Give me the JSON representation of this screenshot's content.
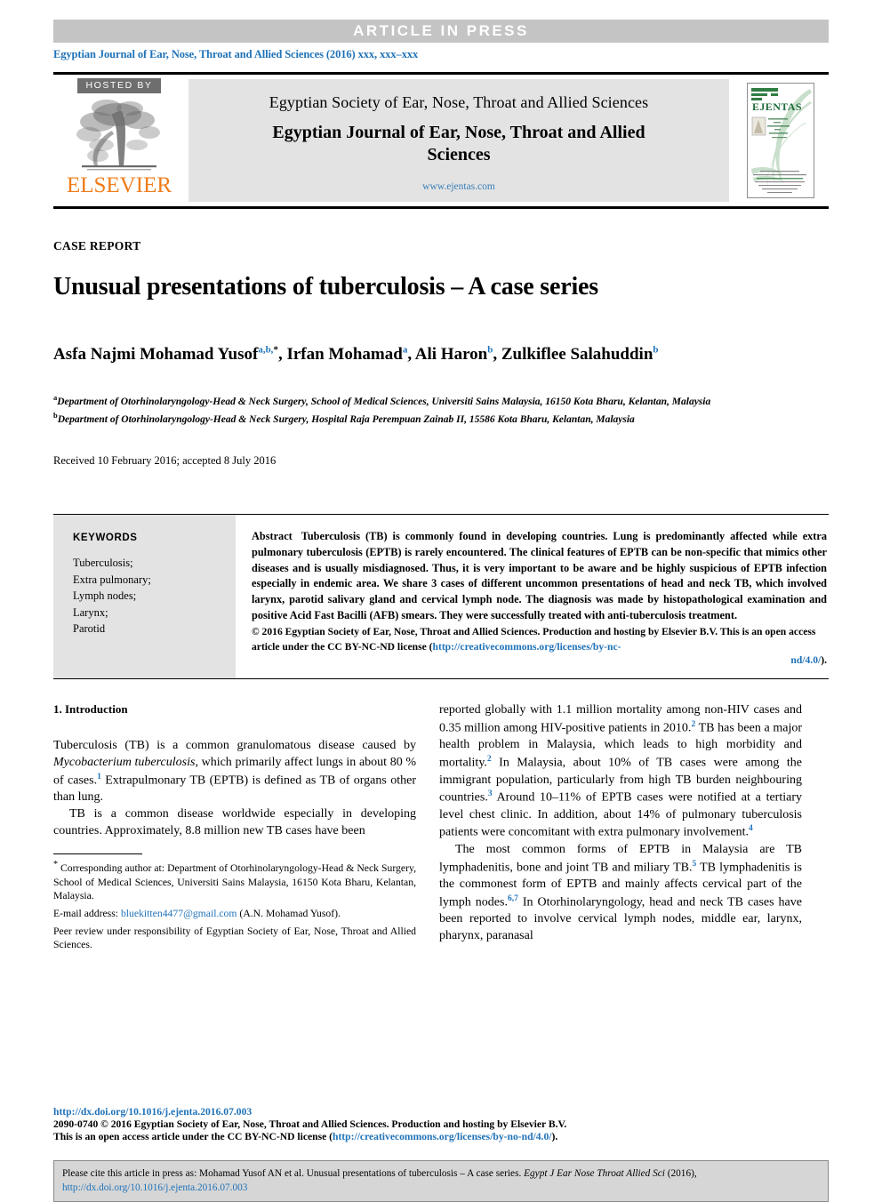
{
  "banner": {
    "label": "ARTICLE  IN  PRESS"
  },
  "running_head": "Egyptian Journal of Ear, Nose, Throat and Allied Sciences (2016) xxx, xxx–xxx",
  "masthead": {
    "hosted_by": "HOSTED BY",
    "publisher": "ELSEVIER",
    "society": "Egyptian Society of Ear, Nose, Throat and Allied Sciences",
    "journal_title": "Egyptian Journal of Ear, Nose, Throat and Allied Sciences",
    "url": "www.ejentas.com",
    "cover_title": "EJENTAS",
    "cover_sub1": "Egyptian Journal",
    "cover_sub2": "of",
    "cover_sub3": "Ear, Nose, Throat",
    "cover_sub4": "and",
    "cover_sub5": "Allied Sciences",
    "cover_sub6": "An official journal of",
    "accent_green": "#1f6b3b",
    "accent_orange": "#ef7d1a"
  },
  "article": {
    "type_label": "CASE REPORT",
    "title": "Unusual presentations of tuberculosis – A case series",
    "authors": [
      {
        "name": "Asfa Najmi Mohamad Yusof",
        "marks": "a,b,",
        "star": "*",
        "sep": ", "
      },
      {
        "name": "Irfan Mohamad",
        "marks": "a",
        "star": "",
        "sep": ", "
      },
      {
        "name": "Ali Haron",
        "marks": "b",
        "star": "",
        "sep": ", "
      },
      {
        "name": "Zulkiflee Salahuddin",
        "marks": "b",
        "star": "",
        "sep": ""
      }
    ],
    "affiliations": [
      {
        "mark": "a",
        "text": "Department of Otorhinolaryngology-Head & Neck Surgery, School of Medical Sciences, Universiti Sains Malaysia, 16150 Kota Bharu, Kelantan, Malaysia"
      },
      {
        "mark": "b",
        "text": "Department of Otorhinolaryngology-Head & Neck Surgery, Hospital Raja Perempuan Zainab II, 15586 Kota Bharu, Kelantan, Malaysia"
      }
    ],
    "received": "Received 10 February 2016; accepted 8 July 2016"
  },
  "keywords": {
    "heading": "KEYWORDS",
    "items": [
      "Tuberculosis;",
      "Extra pulmonary;",
      "Lymph nodes;",
      "Larynx;",
      "Parotid"
    ]
  },
  "abstract": {
    "label": "Abstract",
    "text": "Tuberculosis (TB) is commonly found in developing countries. Lung is predominantly affected while extra pulmonary tuberculosis (EPTB) is rarely encountered. The clinical features of EPTB can be non-specific that mimics other diseases and is usually misdiagnosed. Thus, it is very important to be aware and be highly suspicious of EPTB infection especially in endemic area. We share 3 cases of different uncommon presentations of head and neck TB, which involved larynx, parotid salivary gland and cervical lymph node. The diagnosis was made by histopathological examination and positive Acid Fast Bacilli (AFB) smears. They were successfully treated with anti-tuberculosis treatment.",
    "copyright": "© 2016 Egyptian Society of Ear, Nose, Throat and Allied Sciences. Production and hosting by Elsevier B.V. This is an open access article under the CC BY-NC-ND license (",
    "license_link": "http://creativecommons.org/licenses/by-nc-nd/4.0/",
    "license_link_head": "http://creativecommons.org/licenses/by-nc-",
    "license_link_tail": "nd/4.0/",
    "copyright_end": ")."
  },
  "body": {
    "section_heading": "1. Introduction",
    "left_p1_a": "Tuberculosis (TB) is a common granulomatous disease caused by ",
    "left_p1_italic": "Mycobacterium tuberculosis",
    "left_p1_b": ", which primarily affect lungs in about 80 % of cases.",
    "left_p1_sup": "1",
    "left_p1_c": " Extrapulmonary TB (EPTB) is defined as TB of organs other than lung.",
    "left_p2": "TB is a common disease worldwide especially in developing countries. Approximately, 8.8 million new TB cases have been",
    "right_p1_a": "reported globally with 1.1 million mortality among non-HIV cases and 0.35 million among HIV-positive patients in 2010.",
    "right_p1_sup1": "2",
    "right_p1_b": " TB has been a major health problem in Malaysia, which leads to high morbidity and mortality.",
    "right_p1_sup2": "2",
    "right_p1_c": " In Malaysia, about 10% of TB cases were among the immigrant population, particularly from high TB burden neighbouring countries.",
    "right_p1_sup3": "3",
    "right_p1_d": " Around 10–11% of EPTB cases were notified at a tertiary level chest clinic. In addition, about 14% of pulmonary tuberculosis patients were concomitant with extra pulmonary involvement.",
    "right_p1_sup4": "4",
    "right_p2_a": "The most common forms of EPTB in Malaysia are TB lymphadenitis, bone and joint TB and miliary TB.",
    "right_p2_sup1": "5",
    "right_p2_b": " TB lymphadenitis is the commonest form of EPTB and mainly affects cervical part of the lymph nodes.",
    "right_p2_sup2": "6,7",
    "right_p2_c": " In Otorhinolaryngology, head and neck TB cases have been reported to involve cervical lymph nodes, middle ear, larynx, pharynx, paranasal"
  },
  "footnotes": {
    "corresponding_star": "*",
    "corresponding": "Corresponding author at: Department of Otorhinolaryngology-Head & Neck Surgery, School of Medical Sciences, Universiti Sains Malaysia, 16150 Kota Bharu, Kelantan, Malaysia.",
    "email_label": "E-mail address:",
    "email": "bluekitten4477@gmail.com",
    "email_suffix": "(A.N. Mohamad Yusof).",
    "peer_review": "Peer review under responsibility of Egyptian Society of Ear, Nose, Throat and Allied Sciences."
  },
  "bottom": {
    "doi": "http://dx.doi.org/10.1016/j.ejenta.2016.07.003",
    "issn_line": "2090-0740 © 2016 Egyptian Society of Ear, Nose, Throat and Allied Sciences. Production and hosting by Elsevier B.V.",
    "license_prefix": "This is an open access article under the CC BY-NC-ND license (",
    "license_link": "http://creativecommons.org/licenses/by-no-nd/4.0/",
    "license_suffix": ")."
  },
  "cite_footer": {
    "prefix": "Please cite this article in press as: Mohamad Yusof AN et al. Unusual presentations of tuberculosis – A case series. ",
    "journal_italic": "Egypt J Ear Nose Throat Allied Sci",
    "year": " (2016), ",
    "link": "http://dx.doi.org/10.1016/j.ejenta.2016.07.003"
  }
}
